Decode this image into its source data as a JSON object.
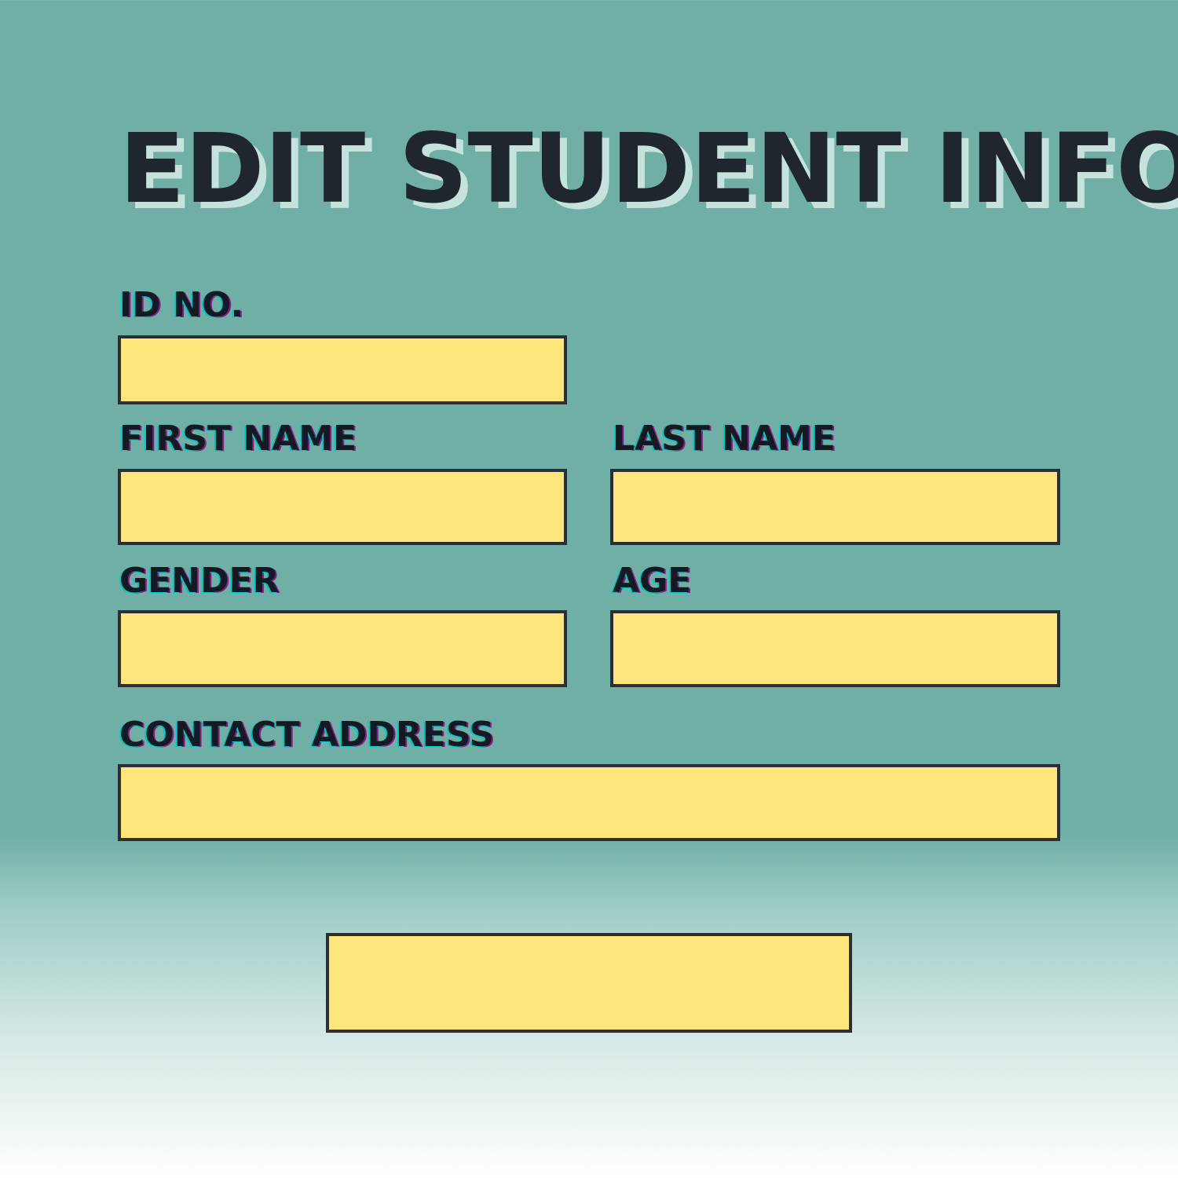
{
  "form": {
    "title": "EDIT STUDENT INFO",
    "fields": {
      "id_no": {
        "label": "ID NO.",
        "value": "",
        "placeholder": ""
      },
      "first_name": {
        "label": "FIRST NAME",
        "value": "",
        "placeholder": ""
      },
      "last_name": {
        "label": "LAST NAME",
        "value": "",
        "placeholder": ""
      },
      "gender": {
        "label": "GENDER",
        "value": "",
        "placeholder": ""
      },
      "age": {
        "label": "AGE",
        "value": "",
        "placeholder": ""
      },
      "contact_address": {
        "label": "CONTACT ADDRESS",
        "value": "",
        "placeholder": ""
      }
    },
    "submit_label": ""
  },
  "colors": {
    "background": "#6fafa6",
    "field_fill": "#fee67c",
    "field_border": "#2b2f33",
    "text": "#20262d",
    "title_shadow": "#c6e2dd"
  }
}
